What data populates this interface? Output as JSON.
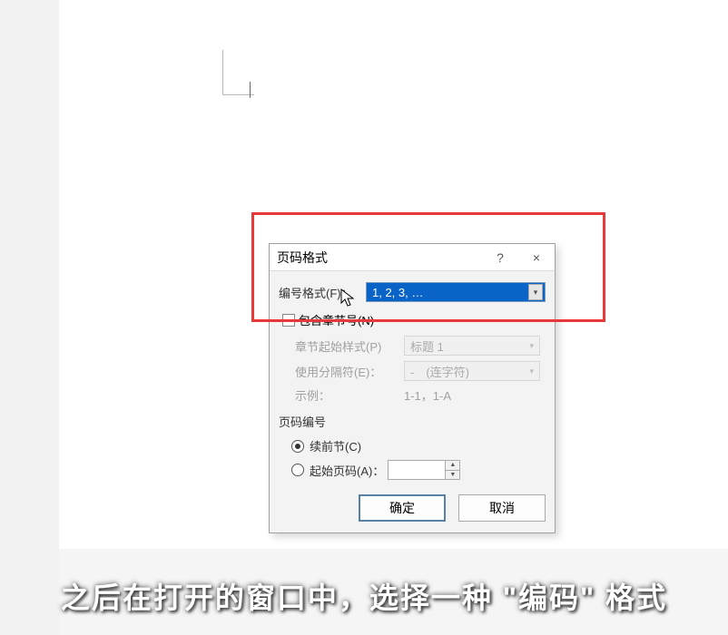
{
  "dialog": {
    "title": "页码格式",
    "help_symbol": "?",
    "close_symbol": "×",
    "format_label": "编号格式(F)：",
    "format_value": "1, 2, 3, …",
    "include_chapter_label": "包含章节号(N)",
    "chapter_style_label": "章节起始样式(P)",
    "chapter_style_value": "标题 1",
    "separator_label": "使用分隔符(E)：",
    "separator_value": "-　(连字符)",
    "example_label": "示例：",
    "example_value": "1-1，1-A",
    "page_numbering_header": "页码编号",
    "continue_label": "续前节(C)",
    "start_at_label": "起始页码(A)：",
    "start_at_value": "",
    "ok_label": "确定",
    "cancel_label": "取消"
  },
  "caption_text": "之后在打开的窗口中，选择一种 \"编码\" 格式"
}
